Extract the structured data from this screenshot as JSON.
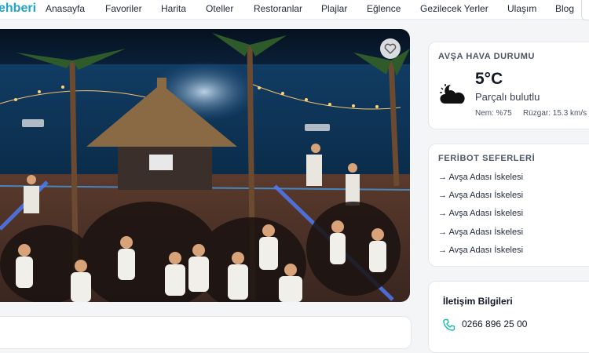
{
  "nav": {
    "logo": "ehberi",
    "items": [
      "Anasayfa",
      "Favoriler",
      "Harita",
      "Oteller",
      "Restoranlar",
      "Plajlar",
      "Eğlence",
      "Gezilecek Yerler",
      "Ulaşım",
      "Blog"
    ]
  },
  "hero": {
    "favorite_icon": "heart-icon"
  },
  "weather": {
    "title": "AVŞA HAVA DURUMU",
    "temperature": "5°C",
    "condition": "Parçalı bulutlu",
    "humidity": "Nem: %75",
    "wind": "Rüzgar: 15.3 km/s",
    "icon": "partly-cloudy-night-icon"
  },
  "ferry": {
    "title": "FERİBOT SEFERLERİ",
    "items": [
      "→ Avşa Adası İskelesi",
      "→ Avşa Adası İskelesi",
      "→ Avşa Adası İskelesi",
      "→ Avşa Adası İskelesi",
      "→ Avşa Adası İskelesi"
    ]
  },
  "contact": {
    "title": "İletişim Bilgileri",
    "phone": "0266 896 25 00",
    "phone_icon": "phone-icon"
  },
  "colors": {
    "brand": "#1fa5c9",
    "accent_phone": "#14b8a6"
  }
}
